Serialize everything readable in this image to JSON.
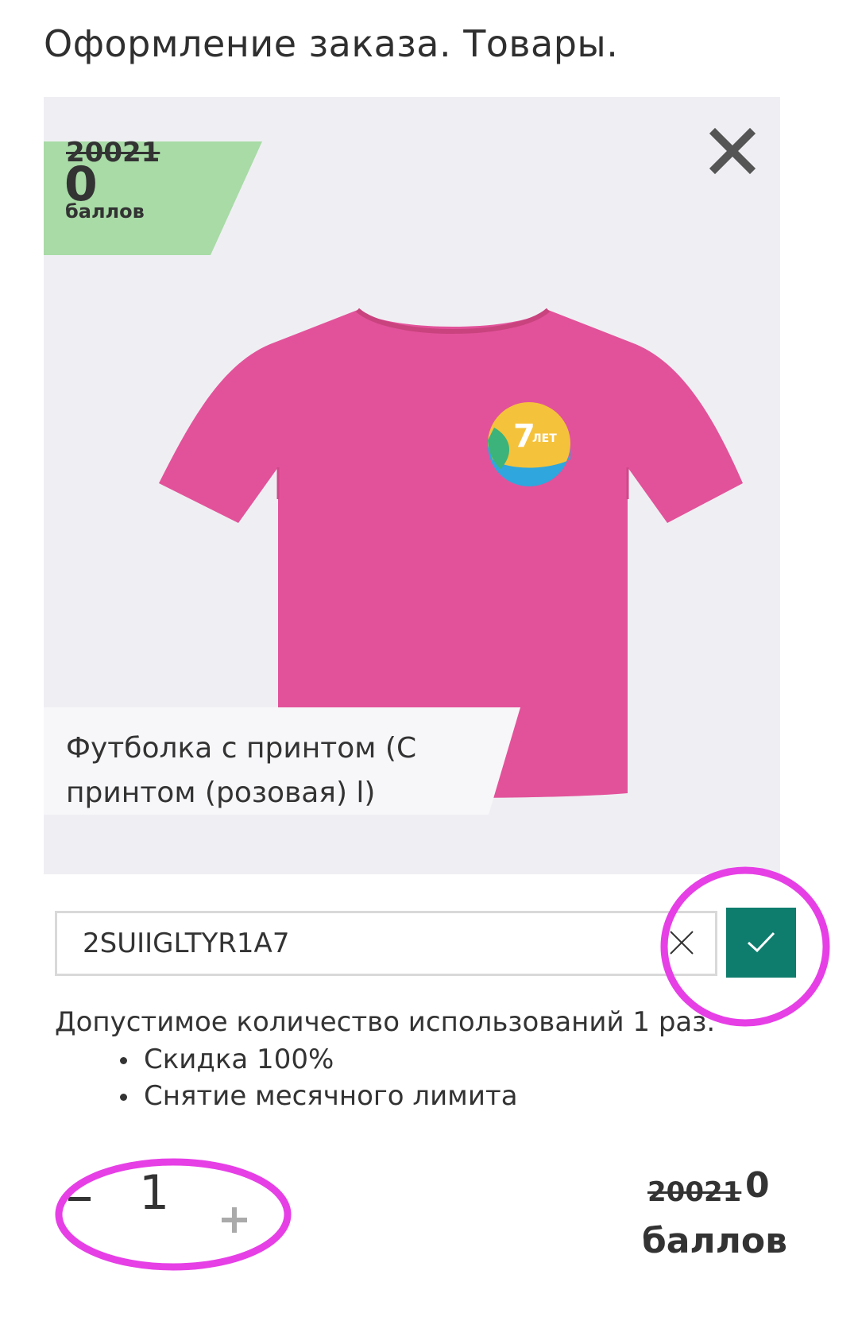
{
  "page": {
    "title": "Оформление заказа. Товары."
  },
  "product": {
    "old_price": "20021",
    "new_price": "0",
    "price_unit": "баллов",
    "name": "Футболка с принтом (С принтом (розовая) l)",
    "image_alt": "розовая футболка с принтом «7 лет с активным гражданином»",
    "print_text": "7",
    "print_subtext": "ЛЕТ"
  },
  "promo": {
    "code": "2SUIIGLTYR1A7",
    "usage_text": "Допустимое количество использований 1 раз.",
    "benefits": [
      "Скидка 100%",
      "Снятие месячного лимита"
    ]
  },
  "quantity": {
    "value": "1",
    "minus_icon": "minus-icon",
    "plus_icon": "plus-icon"
  },
  "total": {
    "old_price": "20021",
    "new_price": "0",
    "unit": "баллов"
  },
  "colors": {
    "badge_green": "#a8dba6",
    "card_bg": "#efeff3",
    "apply_button": "#0e7d6e",
    "tshirt_pink": "#e2529a",
    "annotation_magenta": "#e63fe6"
  }
}
